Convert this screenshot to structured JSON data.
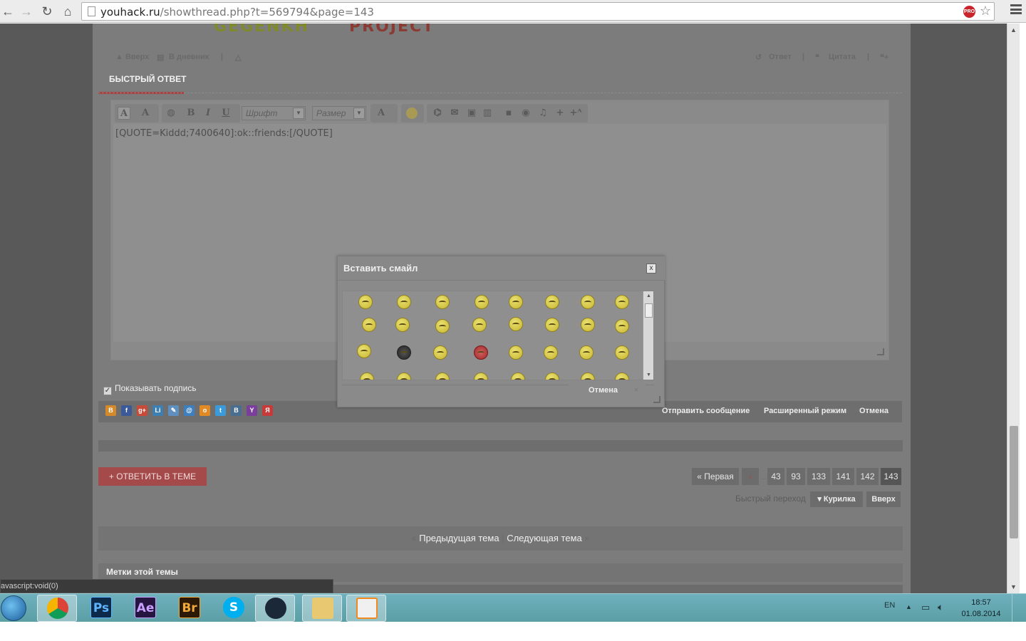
{
  "browser": {
    "url_host": "youhack.ru",
    "url_path": "/showthread.php?t=569794&page=143",
    "back_icon": "back-arrow-icon",
    "forward_icon": "forward-arrow-icon",
    "reload_icon": "reload-icon",
    "home_icon": "home-icon",
    "pro_badge": "PRO"
  },
  "postbar": {
    "up": "▲ Вверх",
    "diary": "В дневник",
    "reply": "Ответ",
    "quote": "Цитата"
  },
  "quick_reply": {
    "title": "БЫСТРЫЙ ОТВЕТ",
    "font_label": "Шрифт",
    "size_label": "Размер",
    "text": "[QUOTE=Kiddd;7400640]:ok::friends:[/QUOTE]"
  },
  "signature_label": "Показывать подпись",
  "actions": {
    "send": "Отправить сообщение",
    "advanced": "Расширенный режим",
    "cancel": "Отмена"
  },
  "reply_thread_button": "+ ОТВЕТИТЬ В ТЕМЕ",
  "pager": {
    "first": "« Первая",
    "prev": "‹",
    "ellipsis": "...",
    "pages": [
      "43",
      "93",
      "133",
      "141",
      "142",
      "143"
    ]
  },
  "jump": {
    "label": "Быстрый переход",
    "selected": "▾ Курилка",
    "top": "Вверх"
  },
  "thread_nav": {
    "prev": "Предыдущая тема",
    "sep": "|",
    "next": "Следующая тема"
  },
  "tags_title": "Метки этой темы",
  "status_bar": "avascript:void(0)",
  "dialog": {
    "title": "Вставить смайл",
    "close": "x",
    "cancel": "Отмена"
  },
  "taskbar": {
    "lang": "EN",
    "time": "18:57",
    "date": "01.08.2014",
    "apps": [
      {
        "name": "chrome",
        "label": ""
      },
      {
        "name": "photoshop",
        "label": "Ps"
      },
      {
        "name": "after-effects",
        "label": "Ae"
      },
      {
        "name": "bridge",
        "label": "Br"
      },
      {
        "name": "skype",
        "label": "S"
      },
      {
        "name": "steam",
        "label": ""
      },
      {
        "name": "explorer",
        "label": ""
      },
      {
        "name": "media-player",
        "label": ""
      }
    ]
  },
  "colors": {
    "accent_red": "#a44a4a",
    "page_bg": "#7c7c7c",
    "overlay_bg": "#595959"
  }
}
